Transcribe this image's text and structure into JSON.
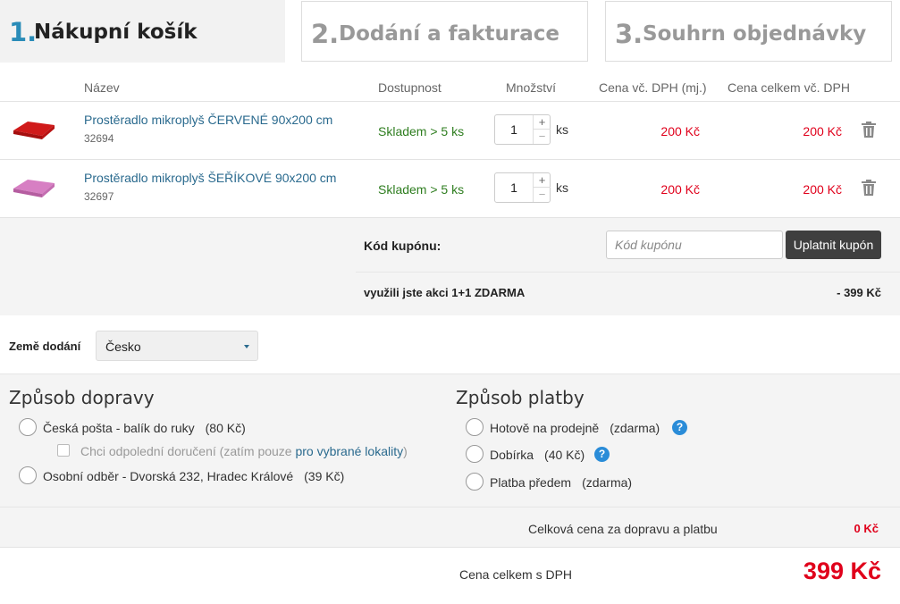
{
  "steps": [
    {
      "num": "1.",
      "label": "Nákupní košík"
    },
    {
      "num": "2.",
      "label": "Dodání a fakturace"
    },
    {
      "num": "3.",
      "label": "Souhrn objednávky"
    }
  ],
  "table": {
    "headers": [
      "Název",
      "Dostupnost",
      "Množství",
      "Cena vč. DPH (mj.)",
      "Cena celkem vč. DPH"
    ]
  },
  "items": [
    {
      "name": "Prostěradlo mikroplyš ČERVENÉ 90x200 cm",
      "code": "32694",
      "availability": "Skladem > 5 ks",
      "quantity": "1",
      "unit": "ks",
      "unit_price": "200 Kč",
      "total_price": "200 Kč",
      "thumb_color": "#d01a1a"
    },
    {
      "name": "Prostěradlo mikroplyš ŠEŘÍKOVÉ 90x200 cm",
      "code": "32697",
      "availability": "Skladem > 5 ks",
      "quantity": "1",
      "unit": "ks",
      "unit_price": "200 Kč",
      "total_price": "200 Kč",
      "thumb_color": "#d77fc3"
    }
  ],
  "qty_controls": {
    "plus": "+",
    "minus": "−"
  },
  "coupon": {
    "label": "Kód kupónu:",
    "placeholder": "Kód kupónu",
    "button": "Uplatnit kupón"
  },
  "promo": {
    "label": "využili jste akci 1+1 ZDARMA",
    "value": "- 399 Kč"
  },
  "country": {
    "label": "Země dodání",
    "selected": "Česko"
  },
  "shipping": {
    "title": "Způsob dopravy",
    "options": [
      {
        "label": "Česká pošta - balík do ruky",
        "price": "(80 Kč)"
      },
      {
        "label": "Osobní odběr - Dvorská 232, Hradec Králové",
        "price": "(39 Kč)"
      }
    ],
    "sub_option": {
      "text": "Chci odpolední doručení (zatím pouze ",
      "link": "pro vybrané lokality",
      "suffix": ")"
    }
  },
  "payment": {
    "title": "Způsob platby",
    "options": [
      {
        "label": "Hotově na prodejně",
        "price": "(zdarma)"
      },
      {
        "label": "Dobírka",
        "price": "(40 Kč)"
      },
      {
        "label": "Platba předem",
        "price": "(zdarma)"
      }
    ],
    "help_glyph": "?"
  },
  "summary": {
    "shipping_payment_label": "Celková cena za dopravu a platbu",
    "shipping_payment_value": "0 Kč",
    "total_label": "Cena celkem s DPH",
    "total_value": "399 Kč"
  },
  "colors": {
    "accent": "#2a8cb8",
    "price": "#e0001b",
    "stock": "#2e7d1f",
    "link": "#2a6a8e"
  }
}
